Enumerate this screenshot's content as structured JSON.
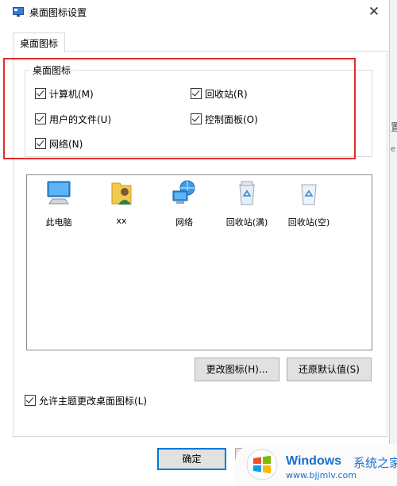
{
  "window": {
    "title": "桌面图标设置",
    "close_glyph": "✕"
  },
  "tabs": [
    {
      "label": "桌面图标",
      "active": true
    }
  ],
  "desktop_icons_group": {
    "legend": "桌面图标",
    "checkboxes": [
      {
        "label": "计算机(M)",
        "checked": true
      },
      {
        "label": "回收站(R)",
        "checked": true
      },
      {
        "label": "用户的文件(U)",
        "checked": true
      },
      {
        "label": "控制面板(O)",
        "checked": true
      },
      {
        "label": "网络(N)",
        "checked": true
      }
    ]
  },
  "icon_list": [
    {
      "label": "此电脑",
      "icon": "computer-icon"
    },
    {
      "label": "xx",
      "icon": "user-folder-icon"
    },
    {
      "label": "网络",
      "icon": "network-icon"
    },
    {
      "label": "回收站(满)",
      "icon": "recycle-bin-full-icon"
    },
    {
      "label": "回收站(空)",
      "icon": "recycle-bin-empty-icon"
    }
  ],
  "buttons": {
    "change_icon": "更改图标(H)...",
    "restore_default": "还原默认值(S)",
    "ok": "确定",
    "cancel": ""
  },
  "allow_themes": {
    "label": "允许主题更改桌面图标(L)",
    "checked": true
  },
  "watermark": {
    "brand": "Windows",
    "brand_suffix": "系统之家",
    "url": "www.bjjmlv.com"
  },
  "background_fragments": [
    "置",
    "e"
  ],
  "colors": {
    "highlight_border": "#e32b2b",
    "default_button_border": "#0078d7",
    "watermark_text": "#1a6fc9"
  }
}
